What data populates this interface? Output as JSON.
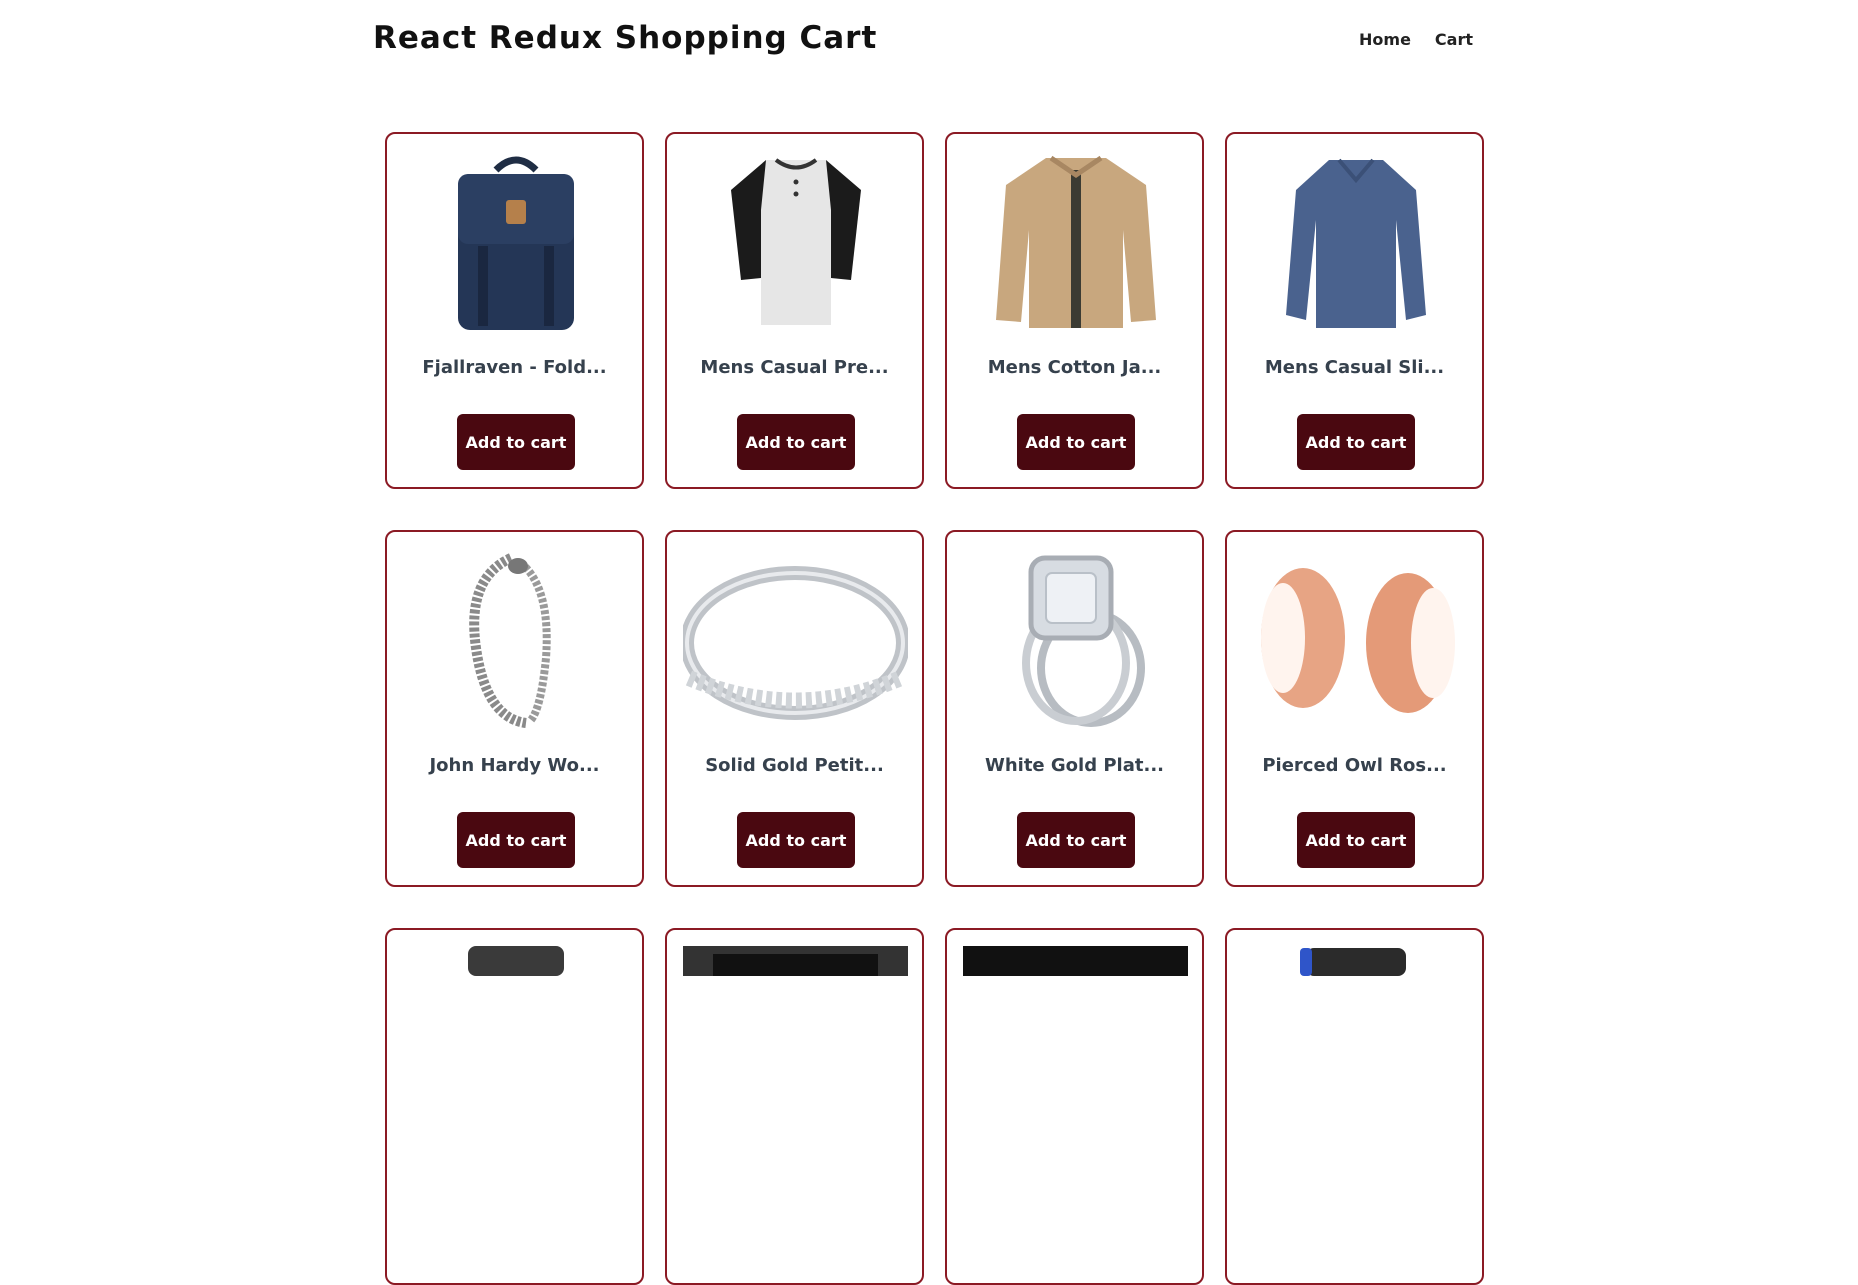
{
  "header": {
    "title": "React Redux Shopping Cart"
  },
  "nav": {
    "home": "Home",
    "cart": "Cart"
  },
  "products": [
    {
      "name": "Fjallraven - Fold...",
      "image_icon": "backpack-icon",
      "button": "Add to cart"
    },
    {
      "name": "Mens Casual Pre...",
      "image_icon": "raglan-tshirt-icon",
      "button": "Add to cart"
    },
    {
      "name": "Mens Cotton Ja...",
      "image_icon": "cotton-jacket-icon",
      "button": "Add to cart"
    },
    {
      "name": "Mens Casual Sli...",
      "image_icon": "long-sleeve-shirt-icon",
      "button": "Add to cart"
    },
    {
      "name": "John Hardy Wo...",
      "image_icon": "chain-bracelet-icon",
      "button": "Add to cart"
    },
    {
      "name": "Solid Gold Petit...",
      "image_icon": "gold-band-ring-icon",
      "button": "Add to cart"
    },
    {
      "name": "White Gold Plat...",
      "image_icon": "diamond-ring-icon",
      "button": "Add to cart"
    },
    {
      "name": "Pierced Owl Ros...",
      "image_icon": "rose-gold-plugs-icon",
      "button": "Add to cart"
    },
    {
      "name": "",
      "image_icon": "hard-drive-icon",
      "button": ""
    },
    {
      "name": "",
      "image_icon": "ssd-icon",
      "button": ""
    },
    {
      "name": "",
      "image_icon": "ssd-black-icon",
      "button": ""
    },
    {
      "name": "",
      "image_icon": "game-drive-icon",
      "button": ""
    }
  ],
  "colors": {
    "card_border": "#8b1a24",
    "button_bg": "#4a0810",
    "button_text": "#ffffff",
    "product_name": "#36414d"
  }
}
